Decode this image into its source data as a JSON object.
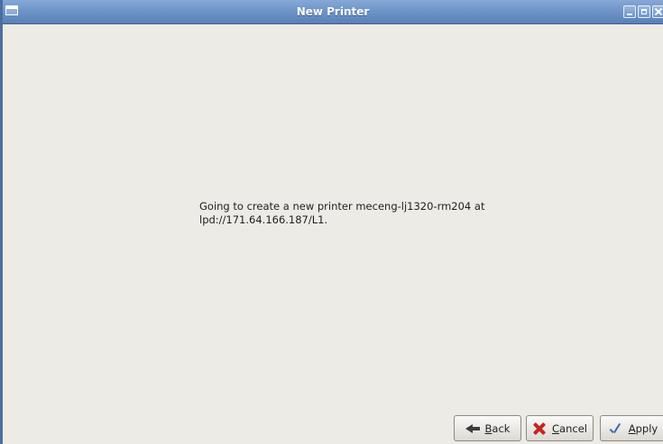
{
  "window": {
    "title": "New Printer",
    "controls": [
      "minimize-icon",
      "maximize-icon",
      "close-icon"
    ],
    "accent_color": "#6f95c8"
  },
  "main": {
    "message_line1": "Going to create a new printer meceng-lj1320-rm204 at",
    "message_line2": "lpd://171.64.166.187/L1."
  },
  "footer": {
    "back": {
      "mnemonic": "B",
      "rest": "ack",
      "icon": "back-arrow-icon"
    },
    "cancel": {
      "mnemonic": "C",
      "rest": "ancel",
      "icon": "cancel-x-icon"
    },
    "apply": {
      "mnemonic": "A",
      "rest": "pply",
      "icon": "apply-check-icon"
    }
  }
}
